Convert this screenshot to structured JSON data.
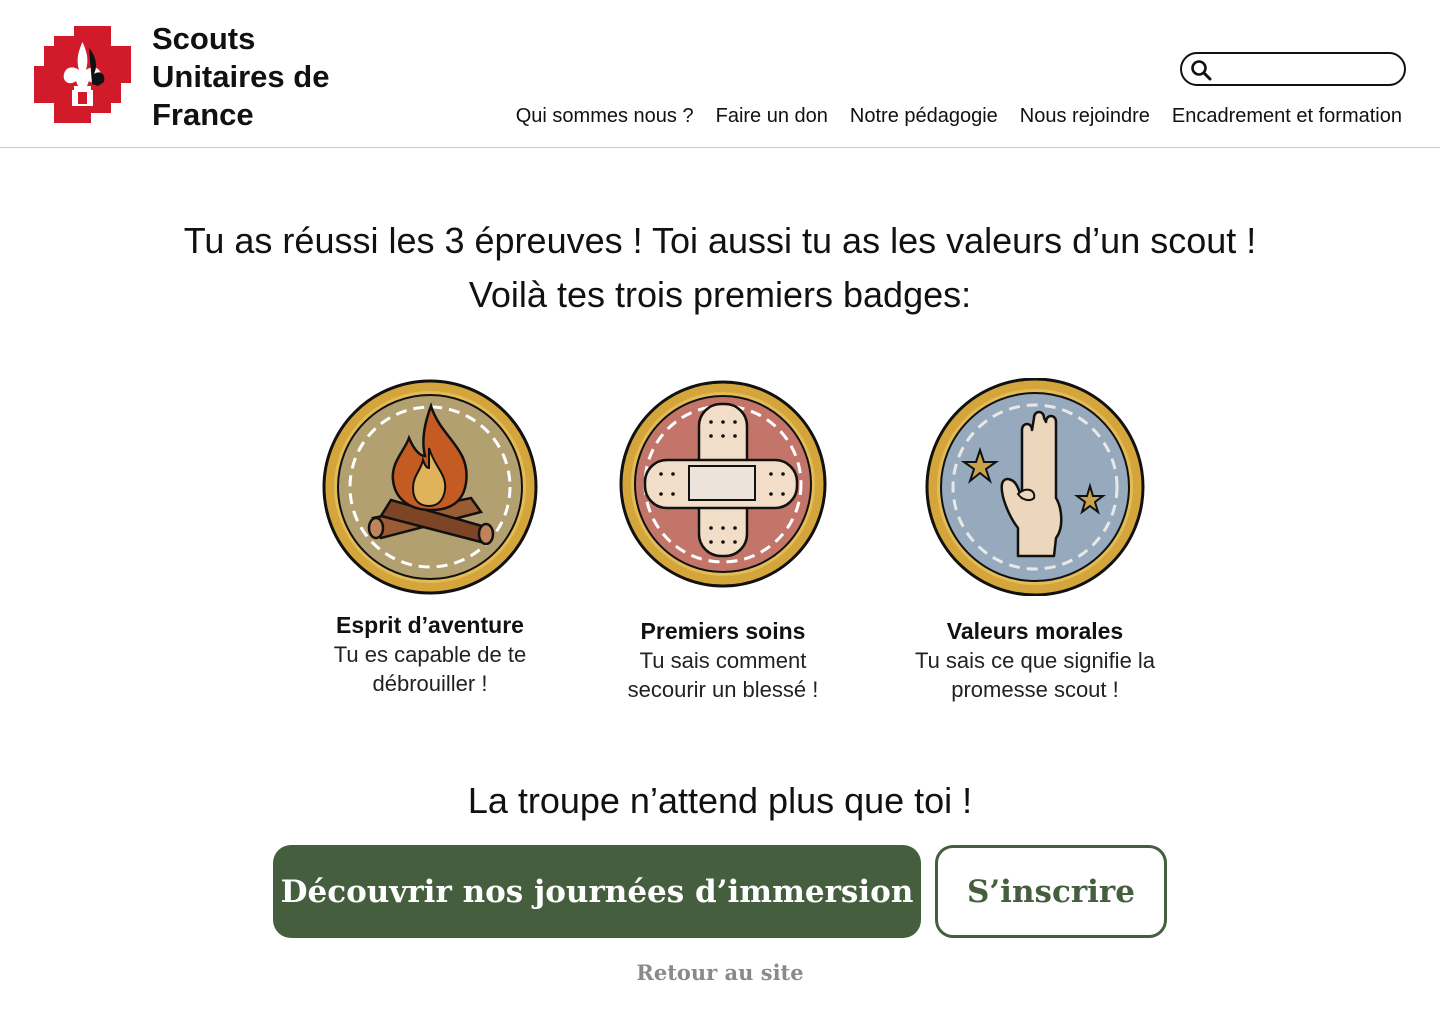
{
  "header": {
    "brand_line1": "Scouts",
    "brand_line2": "Unitaires de",
    "brand_line3": "France",
    "search": {
      "placeholder": "",
      "value": ""
    },
    "nav": [
      {
        "label": "Qui sommes nous ?"
      },
      {
        "label": "Faire un don"
      },
      {
        "label": "Notre pédagogie"
      },
      {
        "label": "Nous rejoindre"
      },
      {
        "label": "Encadrement et formation"
      }
    ]
  },
  "headline": {
    "line1": "Tu as réussi les 3 épreuves ! Toi aussi tu as les valeurs d’un scout !",
    "line2": "Voilà tes trois premiers badges:"
  },
  "badges": [
    {
      "title": "Esprit d’aventure",
      "desc_line1": "Tu es capable de te",
      "desc_line2": "débrouiller !",
      "icon": "campfire-icon",
      "color": "#b3a071"
    },
    {
      "title": "Premiers soins",
      "desc_line1": "Tu sais comment",
      "desc_line2": "secourir un blessé !",
      "icon": "bandage-icon",
      "color": "#c4756a"
    },
    {
      "title": "Valeurs morales",
      "desc_line1": "Tu sais ce que signifie la",
      "desc_line2": "promesse scout !",
      "icon": "scout-salute-hand-icon",
      "color": "#97a9bc"
    }
  ],
  "tagline": "La troupe n’attend plus que toi !",
  "actions": {
    "primary_label": "Découvrir nos journées d’immersion",
    "secondary_label": "S’inscrire",
    "back_label": "Retour au site"
  },
  "colors": {
    "brand_red": "#d11a2a",
    "button_green": "#445e3e",
    "badge_gold": "#d4a53a",
    "muted_gray": "#8a8a8a"
  }
}
